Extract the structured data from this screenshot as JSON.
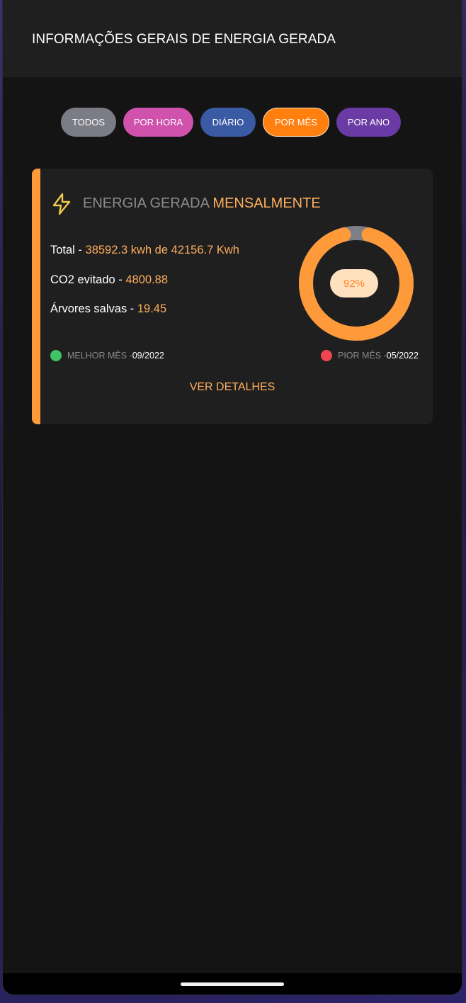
{
  "header": {
    "title": "INFORMAÇÕES GERAIS DE ENERGIA GERADA"
  },
  "filters": [
    {
      "label": "TODOS",
      "color": "#7c7c86",
      "selected": false
    },
    {
      "label": "POR HORA",
      "color": "#d052ad",
      "selected": false
    },
    {
      "label": "DIÁRIO",
      "color": "#3a5aa4",
      "selected": false
    },
    {
      "label": "POR MÊS",
      "color": "#ff7f0f",
      "selected": true
    },
    {
      "label": "POR ANO",
      "color": "#6a3aa5",
      "selected": false
    }
  ],
  "card": {
    "icon": "lightning-bolt-icon",
    "title_prefix": "ENERGIA GERADA",
    "title_highlight": "MENSALMENTE",
    "accent_color": "#ff9a3a",
    "stats": {
      "total_label": "Total - ",
      "total_value": "38592.3 kwh de 42156.7 Kwh",
      "co2_label": "CO2 evitado - ",
      "co2_value": "4800.88",
      "trees_label": "Árvores salvas - ",
      "trees_value": "19.45"
    },
    "gauge": {
      "percent_label": "92%",
      "fraction": 0.92,
      "fill_color": "#ff9a3a",
      "track_color": "#7f7f88"
    },
    "legend": {
      "best_label": "MELHOR MÊS - ",
      "best_date": "09/2022",
      "best_color": "#3fc463",
      "worst_label": "PIOR MÊS - ",
      "worst_date": "05/2022",
      "worst_color": "#f0444f"
    },
    "details_label": "VER DETALHES"
  }
}
